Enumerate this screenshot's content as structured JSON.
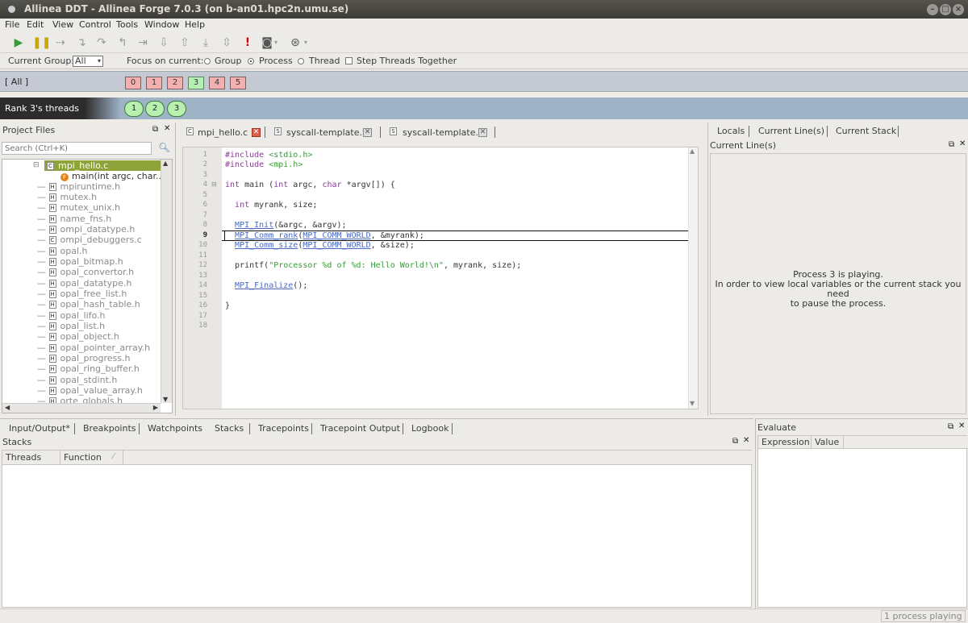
{
  "window": {
    "title": "Allinea DDT - Allinea Forge 7.0.3 (on b-an01.hpc2n.umu.se)"
  },
  "menu": [
    "File",
    "Edit",
    "View",
    "Control",
    "Tools",
    "Window",
    "Help"
  ],
  "focus": {
    "current_group_label": "Current Group:",
    "current_group_value": "All",
    "focus_on_label": "Focus on current:",
    "group": "Group",
    "process": "Process",
    "thread": "Thread",
    "step_threads": "Step Threads Together",
    "selected": "Process"
  },
  "ranks": {
    "group_label": "[ All ]",
    "processes": [
      "0",
      "1",
      "2",
      "3",
      "4",
      "5"
    ],
    "active_process": "3"
  },
  "threads": {
    "label": "Rank 3's threads",
    "items": [
      "1",
      "2",
      "3"
    ]
  },
  "project_files": {
    "title": "Project Files",
    "search_placeholder": "Search (Ctrl+K)",
    "selected_file": "mpi_hello.c",
    "selected_function": "main(int argc, char...",
    "files": [
      "mpiruntime.h",
      "mutex.h",
      "mutex_unix.h",
      "name_fns.h",
      "ompi_datatype.h",
      "ompi_debuggers.c",
      "opal.h",
      "opal_bitmap.h",
      "opal_convertor.h",
      "opal_datatype.h",
      "opal_free_list.h",
      "opal_hash_table.h",
      "opal_lifo.h",
      "opal_list.h",
      "opal_object.h",
      "opal_pointer_array.h",
      "opal_progress.h",
      "opal_ring_buffer.h",
      "opal_stdint.h",
      "opal_value_array.h",
      "orte_globals.h"
    ]
  },
  "editor": {
    "tabs": [
      "mpi_hello.c",
      "syscall-template.S",
      "syscall-template.S"
    ],
    "line_numbers": [
      "1",
      "2",
      "3",
      "4",
      "5",
      "6",
      "7",
      "8",
      "9",
      "10",
      "11",
      "12",
      "13",
      "14",
      "15",
      "16",
      "17",
      "18"
    ],
    "current_line": "9"
  },
  "right_panel": {
    "tabs": [
      "Locals",
      "Current Line(s)",
      "Current Stack"
    ],
    "active_tab": "Current Line(s)",
    "title": "Current Line(s)",
    "message_line1": "Process 3 is playing.",
    "message_line2": "In order to view local variables or the current stack you need",
    "message_line3": "to pause the process."
  },
  "bottom": {
    "tabs": [
      "Input/Output*",
      "Breakpoints",
      "Watchpoints",
      "Stacks",
      "Tracepoints",
      "Tracepoint Output",
      "Logbook"
    ],
    "active_tab": "Stacks",
    "title": "Stacks",
    "columns": [
      "Threads",
      "Function"
    ]
  },
  "evaluate": {
    "title": "Evaluate",
    "columns": [
      "Expression",
      "Value"
    ]
  },
  "status": {
    "text": "1 process playing"
  },
  "colors": {
    "selected_file_bg": "#8ea33a",
    "process_red": "#f2b0b0",
    "process_green": "#b4f0b4",
    "thread_bar": "#9fb3c7"
  }
}
